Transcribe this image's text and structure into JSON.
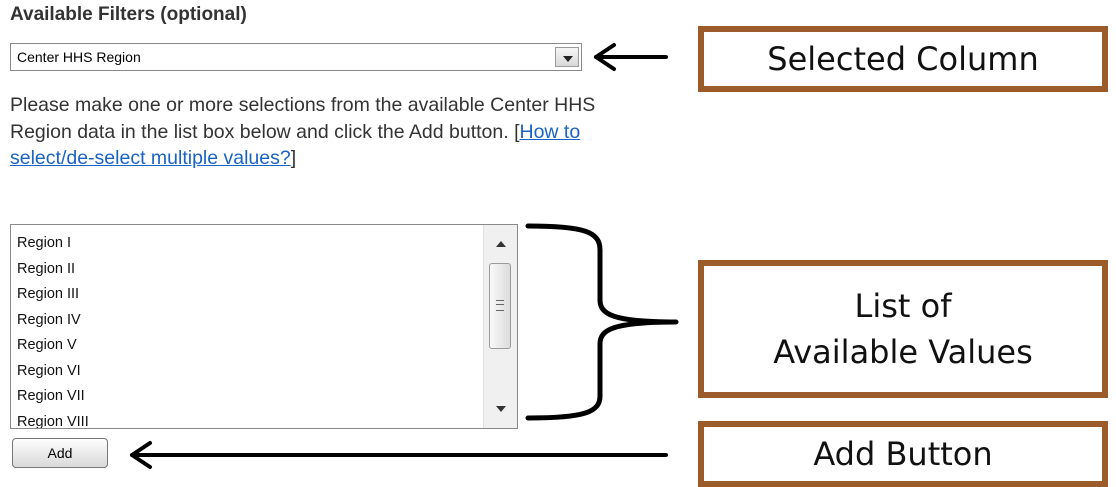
{
  "filters": {
    "heading": "Available Filters (optional)",
    "selected_column": "Center HHS Region",
    "help_text": "Please make one or more selections from the available Center HHS Region data in the list box below and click the Add button. [",
    "help_link": "How to select/de-select multiple values?",
    "help_suffix": "]",
    "list_items": [
      "Region I",
      "Region II",
      "Region III",
      "Region IV",
      "Region V",
      "Region VI",
      "Region VII",
      "Region VIII"
    ],
    "add_label": "Add"
  },
  "callouts": {
    "selected_column": "Selected Column",
    "list_values_line1": "List of",
    "list_values_line2": "Available Values",
    "add_button": "Add Button"
  },
  "colors": {
    "callout_border": "#9c5b2b",
    "link": "#1a63c6"
  }
}
